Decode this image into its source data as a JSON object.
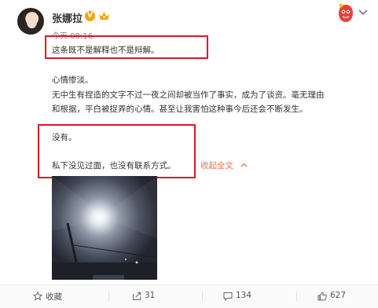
{
  "post": {
    "username": "张娜拉",
    "verified_mark": "V",
    "timestamp": "今天 08:16",
    "lines": [
      "这条既不是解释也不是辩解。",
      "心情惨淡。",
      "无中生有捏造的文字不过一夜之间却被当作了事实，成为了谈资。毫无理由",
      "和根据，平白被捉弄的心情。甚至让我害怕这种事今后还会不断发生。",
      "没有。",
      "私下没见过面，也没有联系方式。"
    ],
    "collapse_label": "收起全文",
    "collapse_icon": "chevron-up-icon"
  },
  "actions": {
    "favorite_label": "收藏",
    "repost_count": "31",
    "comment_count": "134",
    "like_count": "627"
  },
  "colors": {
    "highlight_box": "#d8182a",
    "link": "#eb7350",
    "verified": "#f7a400"
  }
}
